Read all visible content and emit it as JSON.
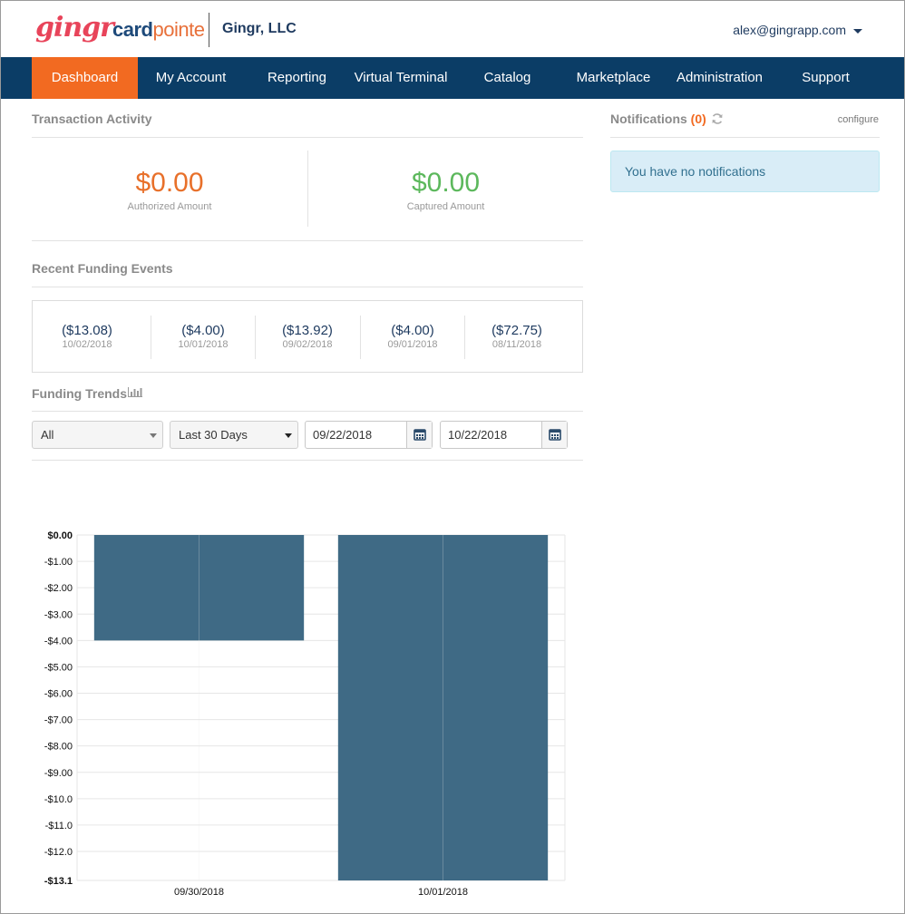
{
  "header": {
    "brand_gingr": "gingr",
    "brand_card": "card",
    "brand_pointe": "pointe",
    "company": "Gingr, LLC",
    "user_email": "alex@gingrapp.com"
  },
  "nav": {
    "items": [
      "Dashboard",
      "My Account",
      "Reporting",
      "Virtual Terminal",
      "Catalog",
      "Marketplace",
      "Administration",
      "Support"
    ],
    "active": "Dashboard"
  },
  "transaction_activity": {
    "title": "Transaction Activity",
    "authorized_amount": "$0.00",
    "authorized_label": "Authorized Amount",
    "captured_amount": "$0.00",
    "captured_label": "Captured Amount"
  },
  "funding_events": {
    "title": "Recent Funding Events",
    "items": [
      {
        "amount": "($13.08)",
        "date": "10/02/2018"
      },
      {
        "amount": "($4.00)",
        "date": "10/01/2018"
      },
      {
        "amount": "($13.92)",
        "date": "09/02/2018"
      },
      {
        "amount": "($4.00)",
        "date": "09/01/2018"
      },
      {
        "amount": "($72.75)",
        "date": "08/11/2018"
      }
    ]
  },
  "funding_trends": {
    "title": "Funding Trends",
    "filter_value": "All",
    "range_value": "Last 30 Days",
    "start_date": "09/22/2018",
    "end_date": "10/22/2018"
  },
  "notifications": {
    "title": "Notifications",
    "count": "(0)",
    "configure_label": "configure",
    "empty_message": "You have no notifications"
  },
  "colors": {
    "nav_bg": "#0b3d66",
    "nav_active": "#f26a21",
    "authorized": "#e8702a",
    "captured": "#5cb85c",
    "bar": "#3f6a85"
  },
  "chart_data": {
    "type": "bar",
    "categories": [
      "09/30/2018",
      "10/01/2018"
    ],
    "values": [
      -4.0,
      -13.1
    ],
    "ylim": [
      -13.1,
      0
    ],
    "y_ticks": [
      "$0.00",
      "-$1.00",
      "-$2.00",
      "-$3.00",
      "-$4.00",
      "-$5.00",
      "-$6.00",
      "-$7.00",
      "-$8.00",
      "-$9.00",
      "-$10.0",
      "-$11.0",
      "-$12.0",
      "-$13.1"
    ],
    "grid": true
  }
}
